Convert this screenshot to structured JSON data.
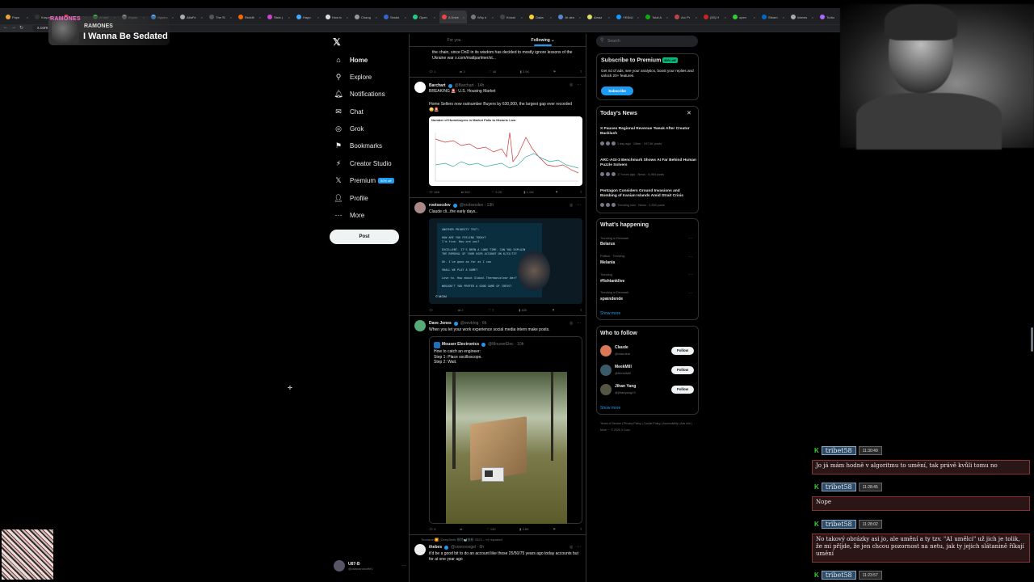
{
  "browser": {
    "tabs": [
      "Pape",
      "Karpat",
      "Rtw-fo",
      "AI dist",
      "Explor",
      "Hyperc",
      "AltaFe",
      "The Si",
      "Reddit",
      "Siste (",
      "Happ",
      "How to",
      "Chang",
      "Sesbd",
      "Open",
      "A Drive",
      "Why d",
      "Knowi",
      "Dada",
      "Je den",
      "Amaz",
      "YE5bU",
      "Total A",
      "Arc Pr",
      "(83) H",
      "open",
      "Steam",
      "Interes",
      "Turbo",
      "Gog"
    ],
    "url": "x.com"
  },
  "music": {
    "album_text": "RAMONES",
    "artist": "RAMONES",
    "title": "I Wanna Be Sedated"
  },
  "sidebar": {
    "items": [
      {
        "label": "Home",
        "icon": "home-icon"
      },
      {
        "label": "Explore",
        "icon": "search-icon"
      },
      {
        "label": "Notifications",
        "icon": "bell-icon"
      },
      {
        "label": "Chat",
        "icon": "mail-icon"
      },
      {
        "label": "Grok",
        "icon": "grok-icon"
      },
      {
        "label": "Bookmarks",
        "icon": "bookmark-icon"
      },
      {
        "label": "Creator Studio",
        "icon": "lightning-icon"
      },
      {
        "label": "Premium",
        "icon": "x-icon"
      },
      {
        "label": "Profile",
        "icon": "person-icon"
      },
      {
        "label": "More",
        "icon": "more-circle-icon"
      }
    ],
    "premium_badge": "50% off",
    "post_label": "Post",
    "user_name": "U87-B",
    "user_handle": "@classandcoffe1"
  },
  "timeline": {
    "tab_for_you": "For you",
    "tab_following": "Following",
    "tweet0": {
      "text": "the chain, since DoD in its wisdom has decided to mostly ignore lessons of the Ukraine war x.com/mattparlmer/st...",
      "replies": "1",
      "reposts": "3",
      "likes": "46",
      "views": "3.9K"
    },
    "tweet1": {
      "name": "Barchart",
      "handle": "@Barchart · 14h",
      "line1": "BREAKING 🚨: U.S. Housing Market",
      "line2": "Home Sellers now outnumber Buyers by 630,000, the largest gap ever recorded 😳🚨",
      "chart_title": "Number of Homebuyers in Market Falls to Historic Low",
      "replies": "168",
      "reposts": "552",
      "likes": "3.2K",
      "views": "1.1M"
    },
    "tweet2": {
      "name": "rootsecdev",
      "handle": "@rootsecdev · 13h",
      "text": "Claude cli...the early days..",
      "screen_text": "ANOTHER PRIORITY TEXT:\n\nHOW ARE YOU FEELING TODAY?\nI'm fine. How are you?\n\nEXCELLENT. IT'S BEEN A LONG TIME. CAN YOU EXPLAIN\nTHE REMOVAL OF YOUR USER ACCOUNT ON 6/23/73?\n\nOh. I've gone as far as I can\n\nSHALL WE PLAY A GAME?\n\nLove to. How about Global Thermonuclear War?\n\nWOULDN'T YOU PREFER A GOOD GAME OF CHESS?",
      "video_label": "© MGM",
      "replies": "",
      "reposts": "2",
      "likes": "7",
      "views": "830"
    },
    "tweet3": {
      "name": "Dave Jones",
      "handle": "@eevblog · 6h",
      "text": "When you let your work experience social media intern make posts.",
      "quote_name": "Mouser Electronics",
      "quote_handle": "@MouserElec · 10h",
      "quote_text": "How to catch an engineer:\nStep 1: Place oscilloscope.\nStep 2: Wait.",
      "replies": "9",
      "reposts": "",
      "likes": "130",
      "views": "3.6K"
    },
    "tweet4": {
      "repost_note": "Teortaxes▶️ (DeepSeek 推特🐋铁粉 2023 – ∞) reposted",
      "name": "thebes",
      "handle": "@voooooogel · 6h",
      "text": "it'd be a good bit to do an account like those 25/50/75 years ago today accounts but for ai one year ago"
    }
  },
  "right": {
    "search_placeholder": "Search",
    "premium_title": "Subscribe to Premium",
    "premium_badge": "50% off",
    "premium_desc": "Get rid of ads, see your analytics, boost your replies and unlock 20+ features.",
    "subscribe": "Subscribe",
    "news_title": "Today's News",
    "news": [
      {
        "title": "X Pauses Regional Revenue Tweak After Creator Backlash",
        "meta": "1 day ago · Other · 197.5K posts"
      },
      {
        "title": "ARC-AGI-3 Benchmark Shows AI Far Behind Human Puzzle Solvers",
        "meta": "17 hours ago · News · 6,464 posts"
      },
      {
        "title": "Pentagon Considers Ground Invasions and Bombing of Iranian Islands Amid Strait Crisis",
        "meta": "Trending now · News · 2,259 posts"
      }
    ],
    "happening_title": "What's happening",
    "trends": [
      {
        "meta": "Trending in Denmark",
        "name": "Belarus"
      },
      {
        "meta": "Politics · Trending",
        "name": "Melania"
      },
      {
        "meta": "Trending",
        "name": "#fishtanklive"
      },
      {
        "meta": "Trending in Denmark",
        "name": "spændende"
      }
    ],
    "show_more": "Show more",
    "follow_title": "Who to follow",
    "follow": [
      {
        "name": "Claude",
        "handle": "@claudeai",
        "btn": "Follow"
      },
      {
        "name": "MeekMill",
        "handle": "@MeekMill",
        "btn": "Follow"
      },
      {
        "name": "Jihan Yang",
        "handle": "@jihanyang13",
        "btn": "Follow"
      }
    ],
    "footer": "Terms of Service | Privacy Policy | Cookie Policy | Accessibility | Ads info | More ··· © 2026 X Corp."
  },
  "chat": [
    {
      "user": "tribet58",
      "time": "11:30:49",
      "msg": "Jo já mám hodně v algoritmu to umění, tak právě kvůli tomu no"
    },
    {
      "user": "tribet58",
      "time": "11:28:45",
      "msg": "Nope"
    },
    {
      "user": "tribet58",
      "time": "11:28:02",
      "msg": "No takový obrázky asi jo, ale umění a ty tzv. \"AI umělci\" už jich je tolik, že mi příjde, že jen chcou pozornost na netu, jak ty jejich slátanině říkají umění"
    },
    {
      "user": "tribet58",
      "time": "11:23:57",
      "msg": ""
    }
  ],
  "colors": {
    "accent": "#1d9bf0",
    "chat_user": "#2d4a66",
    "chat_msg": "#2a1616"
  }
}
